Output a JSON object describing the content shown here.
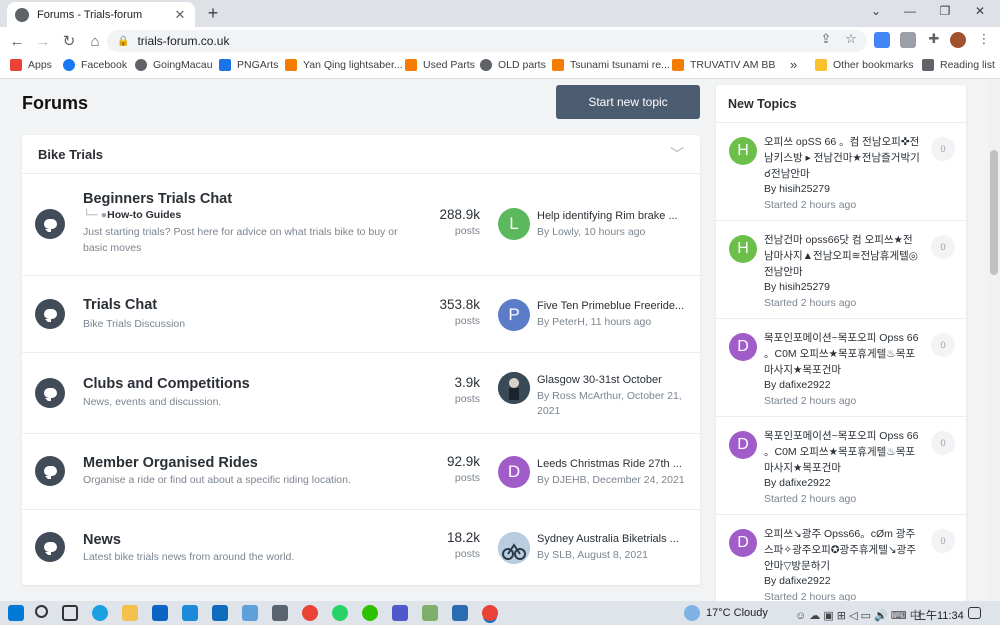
{
  "browser": {
    "tab_title": "Forums - Trials-forum",
    "tab_close": "✕",
    "new_tab": "+",
    "url": "trials-forum.co.uk",
    "bookmarks": [
      {
        "label": "Apps",
        "color": "#ea4335"
      },
      {
        "label": "Facebook",
        "color": "#1877f2"
      },
      {
        "label": "GoingMacau",
        "color": "#5f6368"
      },
      {
        "label": "PNGArts",
        "color": "#1a73e8"
      },
      {
        "label": "Yan Qing lightsaber...",
        "color": "#f57c00"
      },
      {
        "label": "Used Parts",
        "color": "#f57c00"
      },
      {
        "label": "OLD parts",
        "color": "#5f6368"
      },
      {
        "label": "Tsunami tsunami re...",
        "color": "#f57c00"
      },
      {
        "label": "TRUVATIV AM BB",
        "color": "#f57c00"
      }
    ],
    "bookmarks_more": "»",
    "other_bookmarks": "Other bookmarks",
    "reading_list": "Reading list"
  },
  "page": {
    "title": "Forums",
    "start_button": "Start new topic",
    "category": "Bike Trials",
    "forums": [
      {
        "name": "Beginners Trials Chat",
        "subforum": "How-to Guides",
        "description": "Just starting trials? Post here for advice on what trials bike to buy or basic moves",
        "count": "288.9k",
        "count_label": "posts",
        "avatar_letter": "L",
        "avatar_color": "#5cb85c",
        "last_title": "Help identifying Rim brake ...",
        "last_by": "By Lowly, 10 hours ago"
      },
      {
        "name": "Trials Chat",
        "description": "Bike Trials Discussion",
        "count": "353.8k",
        "count_label": "posts",
        "avatar_letter": "P",
        "avatar_color": "#5c7cc8",
        "last_title": "Five Ten Primeblue Freeride...",
        "last_by": "By PeterH, 11 hours ago"
      },
      {
        "name": "Clubs and Competitions",
        "description": "News, events and discussion.",
        "count": "3.9k",
        "count_label": "posts",
        "avatar_letter": "",
        "avatar_color": "#2f3a45",
        "last_title": "Glasgow 30-31st October",
        "last_by": "By Ross McArthur, October 21, 2021"
      },
      {
        "name": "Member Organised Rides",
        "description": "Organise a ride or find out about a specific riding location.",
        "count": "92.9k",
        "count_label": "posts",
        "avatar_letter": "D",
        "avatar_color": "#a05cc8",
        "last_title": "Leeds Christmas Ride 27th ...",
        "last_by": "By DJEHB, December 24, 2021"
      },
      {
        "name": "News",
        "description": "Latest bike trials news from around the world.",
        "count": "18.2k",
        "count_label": "posts",
        "avatar_letter": "",
        "avatar_color": "#9fb3c8",
        "last_title": "Sydney Australia Biketrials ...",
        "last_by": "By SLB, August 8, 2021"
      }
    ]
  },
  "sidebar": {
    "title": "New Topics",
    "topics": [
      {
        "letter": "H",
        "color": "#6cc04a",
        "title": "오피쓰 opSS 66 。컴 전남오피✜전남키스방 ▸ 전남건마★전남즐거박기☌전남안마",
        "by": "By hisih25279",
        "when": "Started 2 hours ago",
        "count": "0"
      },
      {
        "letter": "H",
        "color": "#6cc04a",
        "title": "전남건마 opss66닷 컴 오피쓰★전남마사지▲전남오피≋전남휴게텔◎전남안마",
        "by": "By hisih25279",
        "when": "Started 2 hours ago",
        "count": "0"
      },
      {
        "letter": "D",
        "color": "#a05cc8",
        "title": "목포인포메이션~목포오피 Opss 66 。C0M 오피쓰★목포휴게텔♨목포마사지★목포건마",
        "by": "By dafixe2922",
        "when": "Started 2 hours ago",
        "count": "0"
      },
      {
        "letter": "D",
        "color": "#a05cc8",
        "title": "목포인포메이션~목포오피 Opss 66 。C0M 오피쓰★목포휴게텔♨목포마사지★목포건마",
        "by": "By dafixe2922",
        "when": "Started 2 hours ago",
        "count": "0"
      },
      {
        "letter": "D",
        "color": "#a05cc8",
        "title": "오피쓰↘광주 Opss66。cØm 광주스파✧광주오피✪광주휴게텔↘광주안마▽방문하기",
        "by": "By dafixe2922",
        "when": "Started 2 hours ago",
        "count": "0"
      }
    ]
  },
  "taskbar": {
    "weather": "17°C  Cloudy",
    "clock": "上午11:34"
  }
}
